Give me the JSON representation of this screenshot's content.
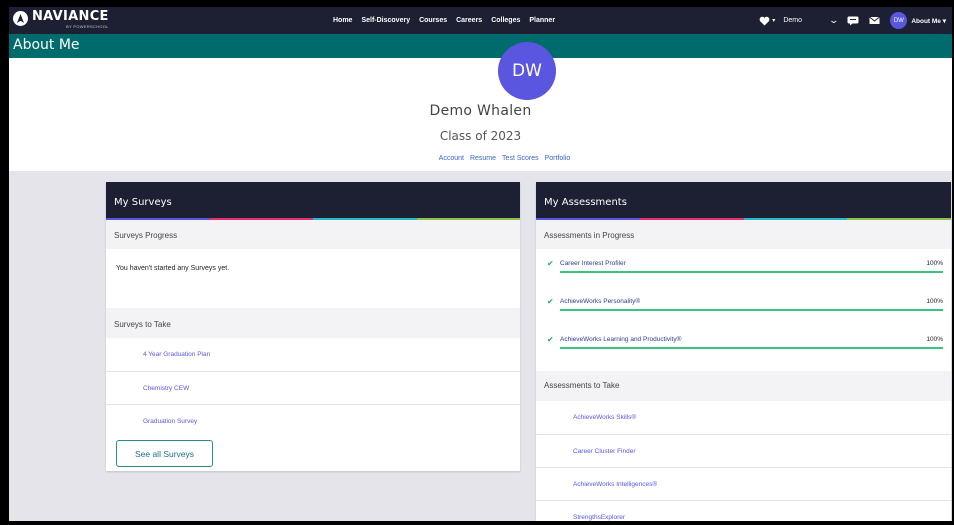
{
  "nav": {
    "logo_text": "NAVIANCE",
    "logo_sub": "BY POWERSCHOOL",
    "links": [
      "Home",
      "Self-Discovery",
      "Courses",
      "Careers",
      "Colleges",
      "Planner"
    ],
    "demo_label": "Demo",
    "avatar_initials": "DW",
    "about_label": "About Me ▾",
    "icons": [
      "heart-icon",
      "chevron-down-icon",
      "message-icon",
      "mail-icon"
    ]
  },
  "page": {
    "title": "About Me"
  },
  "profile": {
    "initials": "DW",
    "name": "Demo Whalen",
    "class_year": "Class of 2023",
    "links": [
      "Account",
      "Resume",
      "Test Scores",
      "Portfolio"
    ],
    "avatar_color": "#5a56e0"
  },
  "surveys": {
    "title": "My Surveys",
    "progress_label": "Surveys Progress",
    "empty_message": "You haven't started any Surveys yet.",
    "to_take_label": "Surveys to Take",
    "items": [
      "4 Year Graduation Plan",
      "Chemistry CEW",
      "Graduation Survey"
    ],
    "see_all": "See all Surveys"
  },
  "assessments": {
    "title": "My Assessments",
    "progress_label": "Assessments in Progress",
    "in_progress": [
      {
        "name": "Career Interest Profiler",
        "percent": "100%",
        "fraction": 1.0
      },
      {
        "name": "AchieveWorks Personality®",
        "percent": "100%",
        "fraction": 1.0
      },
      {
        "name": "AchieveWorks Learning and Productivity®",
        "percent": "100%",
        "fraction": 1.0
      }
    ],
    "to_take_label": "Assessments to Take",
    "items": [
      "AchieveWorks Skills®",
      "Career Cluster Finder",
      "AchieveWorks Intelligences®",
      "StrengthsExplorer"
    ]
  },
  "colors": {
    "nav_bg": "#1d1f33",
    "teal": "#006b6c",
    "accent_purple": "#5a56e0",
    "progress_green": "#37c581",
    "stripe": [
      "#5a56e0",
      "#e5306d",
      "#2ab7c9",
      "#8bc34a"
    ]
  }
}
